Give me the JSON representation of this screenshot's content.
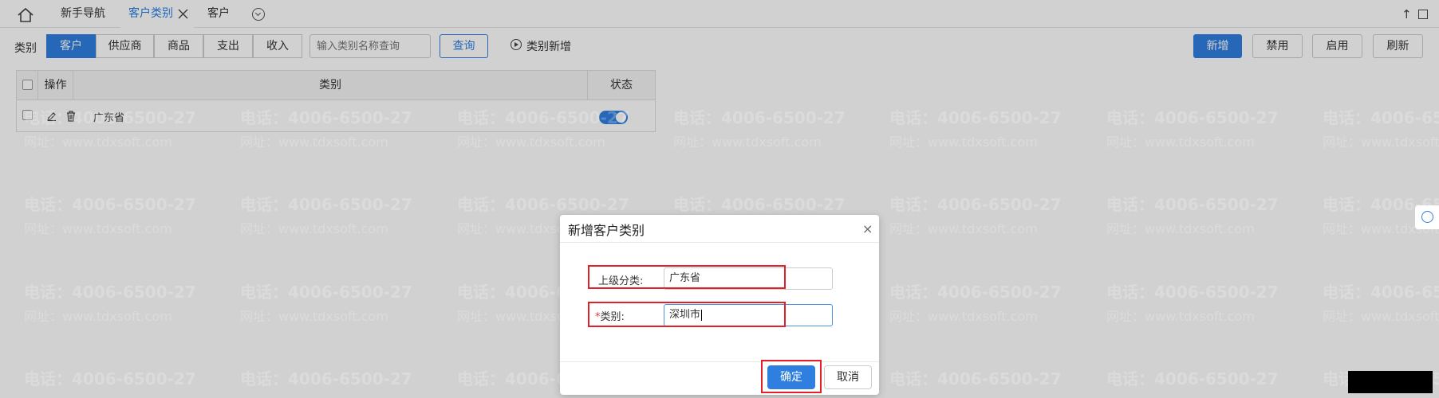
{
  "tabs": {
    "items": [
      {
        "label": "新手导航"
      },
      {
        "label": "客户类别",
        "active": true
      },
      {
        "label": "客户"
      }
    ]
  },
  "toolbar": {
    "category_label": "类别",
    "segments": [
      "客户",
      "供应商",
      "商品",
      "支出",
      "收入"
    ],
    "search_placeholder": "输入类别名称查询",
    "query_label": "查询",
    "add_category_label": "类别新增",
    "right_buttons": [
      "新增",
      "禁用",
      "启用",
      "刷新"
    ]
  },
  "table": {
    "headers": [
      "操作",
      "类别",
      "状态"
    ],
    "rows": [
      {
        "category": "广东省",
        "status_on": true
      }
    ]
  },
  "watermark": {
    "phone": "电话：4006-6500-27",
    "site": "网址：www.tdxsoft.com"
  },
  "dialog": {
    "title": "新增客户类别",
    "close": "×",
    "parent_label": "上级分类:",
    "parent_value": "广东省",
    "category_required": "*",
    "category_label": "类别:",
    "category_value": "深圳市",
    "ok_label": "确定",
    "cancel_label": "取消"
  },
  "colors": {
    "accent": "#2f7fe0",
    "highlight": "#e0212a"
  }
}
